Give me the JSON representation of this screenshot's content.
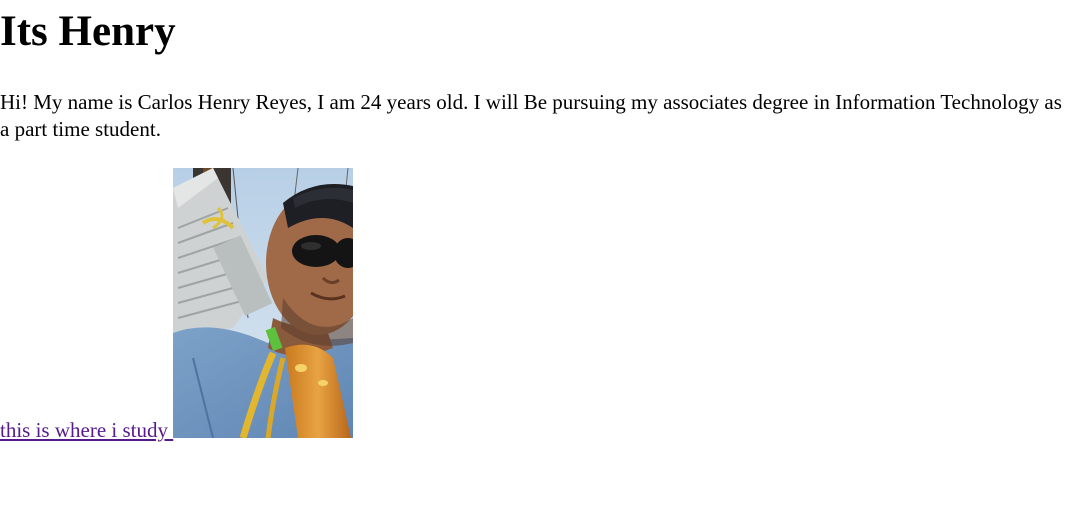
{
  "page": {
    "heading": "Its Henry",
    "intro": "Hi! My name is Carlos Henry Reyes, I am 24 years old. I will Be pursuing my associates degree in Information Technology as a part time student.",
    "link_text": "this is where i study ",
    "link_color": "#551a8b",
    "photo_alt": "selfie photo"
  }
}
